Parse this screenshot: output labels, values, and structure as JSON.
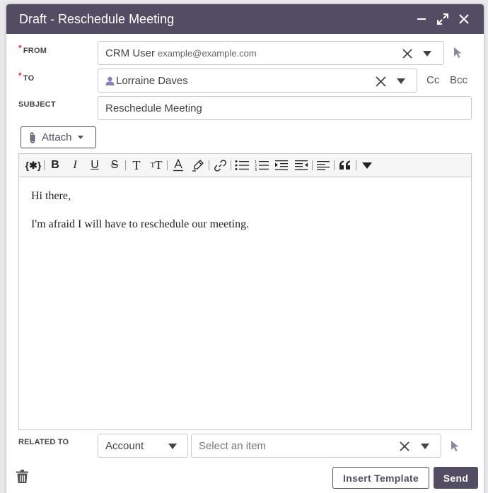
{
  "dialog": {
    "title": "Draft - Reschedule Meeting"
  },
  "from": {
    "label": "FROM",
    "name": "CRM User",
    "email": "example@example.com"
  },
  "to": {
    "label": "TO",
    "recipient": "Lorraine Daves",
    "cc_label": "Cc",
    "bcc_label": "Bcc"
  },
  "subject": {
    "label": "SUBJECT",
    "value": "Reschedule Meeting"
  },
  "attach": {
    "label": "Attach"
  },
  "body": {
    "line1": "Hi there,",
    "line2": "I'm afraid I will have to reschedule our meeting."
  },
  "related": {
    "label": "RELATED TO",
    "type_value": "Account",
    "item_placeholder": "Select an item"
  },
  "footer": {
    "insert_template_label": "Insert Template",
    "send_label": "Send"
  },
  "colors": {
    "header": "#534d64",
    "required": "#dd3333",
    "pointer_icon": "#8a8a9c"
  }
}
